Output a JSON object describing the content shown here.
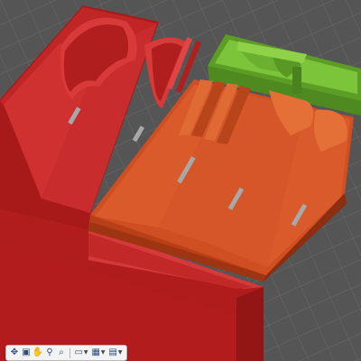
{
  "viewport": {
    "background": "#565656",
    "grid_color": "#6a6a6a",
    "grid_major_color": "#7b7b7b"
  },
  "model": {
    "trays": [
      {
        "name": "large-red-tray",
        "color": "#b81e1e"
      },
      {
        "name": "orange-tray",
        "color": "#c8461c"
      },
      {
        "name": "green-tray",
        "color": "#69b02b"
      },
      {
        "name": "long-red-tray",
        "color": "#b81e1e"
      }
    ]
  },
  "navigation_bar": {
    "tools": [
      {
        "id": "orbit",
        "icon": "orbit-icon",
        "glyph": "✥"
      },
      {
        "id": "look-at",
        "icon": "look-at-icon",
        "glyph": "▣"
      },
      {
        "id": "pan",
        "icon": "pan-hand-icon",
        "glyph": "✋"
      },
      {
        "id": "zoom",
        "icon": "zoom-icon",
        "glyph": "⚲"
      },
      {
        "id": "fit",
        "icon": "zoom-window-icon",
        "glyph": "⌕"
      },
      {
        "id": "display-settings",
        "icon": "display-settings-icon",
        "glyph": "▭",
        "dropdown": true
      },
      {
        "id": "grid-snaps",
        "icon": "grid-snaps-icon",
        "glyph": "▦",
        "dropdown": true
      },
      {
        "id": "viewports",
        "icon": "viewports-icon",
        "glyph": "▤",
        "dropdown": true
      }
    ]
  }
}
